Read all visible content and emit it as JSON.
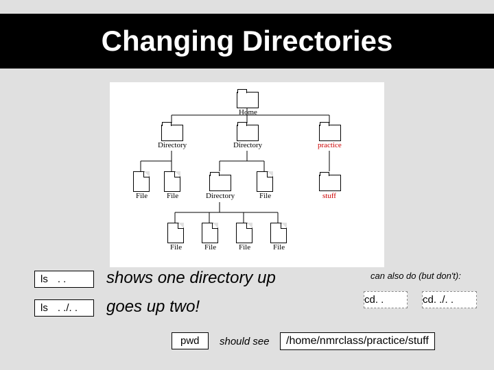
{
  "title": "Changing Directories",
  "diagram": {
    "home": "Home",
    "dir1": "Directory",
    "dir2": "Directory",
    "practice": "practice",
    "file_a": "File",
    "file_b": "File",
    "dir3": "Directory",
    "file_c": "File",
    "stuff": "stuff",
    "file_d": "File",
    "file_e": "File",
    "file_f": "File",
    "file_g": "File"
  },
  "cmd1_a": "ls",
  "cmd1_b": ". .",
  "cmd2_a": "ls",
  "cmd2_b": ". ./. .",
  "desc1": "shows one directory up",
  "desc2": "goes up two!",
  "note": "can also do (but don't):",
  "cd1_a": "cd",
  "cd1_b": ". .",
  "cd2_a": "cd",
  "cd2_b": ". ./. .",
  "pwd": "pwd",
  "should_see": "should see",
  "path": "/home/nmrclass/practice/stuff"
}
